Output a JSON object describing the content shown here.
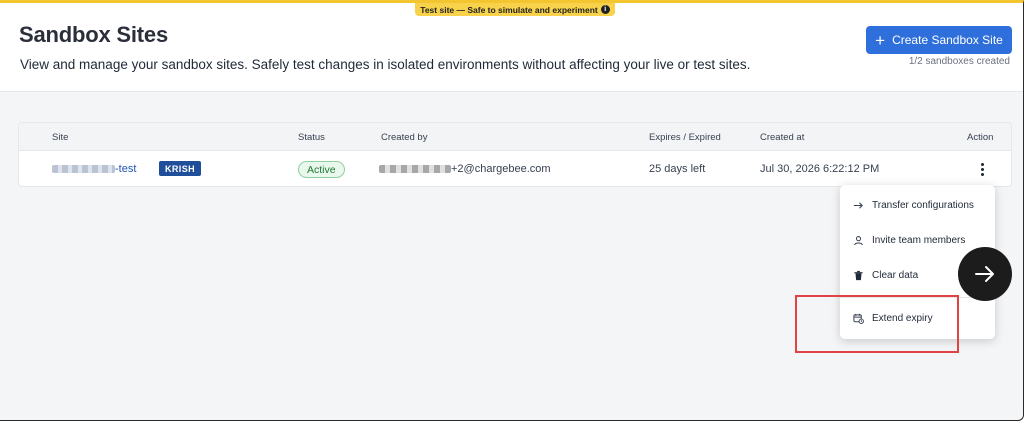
{
  "banner": {
    "text": "Test site — Safe to simulate and experiment",
    "info_glyph": "i"
  },
  "header": {
    "title": "Sandbox Sites",
    "subtitle": "View and manage your sandbox sites. Safely test changes in isolated environments without affecting your live or test sites.",
    "create_button": {
      "plus": "+",
      "label": "Create Sandbox Site"
    },
    "quota": "1/2 sandboxes created"
  },
  "table": {
    "columns": [
      "Site",
      "Status",
      "Created by",
      "Expires / Expired",
      "Created at",
      "Action"
    ],
    "rows": [
      {
        "site_suffix": "-test",
        "badge": "KRISH",
        "status": "Active",
        "created_by_suffix": "+2@chargebee.com",
        "expires": "25 days left",
        "created_at": "Jul 30, 2026 6:22:12 PM"
      }
    ]
  },
  "action_menu": {
    "items": [
      {
        "label": "Transfer configurations",
        "icon": "arrow-right-icon"
      },
      {
        "label": "Invite team members",
        "icon": "person-icon"
      },
      {
        "label": "Clear data",
        "icon": "trash-icon"
      },
      {
        "label": "Extend expiry",
        "icon": "calendar-clock-icon"
      }
    ]
  },
  "colors": {
    "banner": "#f7d24a",
    "primary": "#2f6fdc",
    "badge": "#1f4e9a",
    "status_active": "#1e7a35",
    "highlight": "#e04343",
    "fab": "#1c1c1c"
  }
}
